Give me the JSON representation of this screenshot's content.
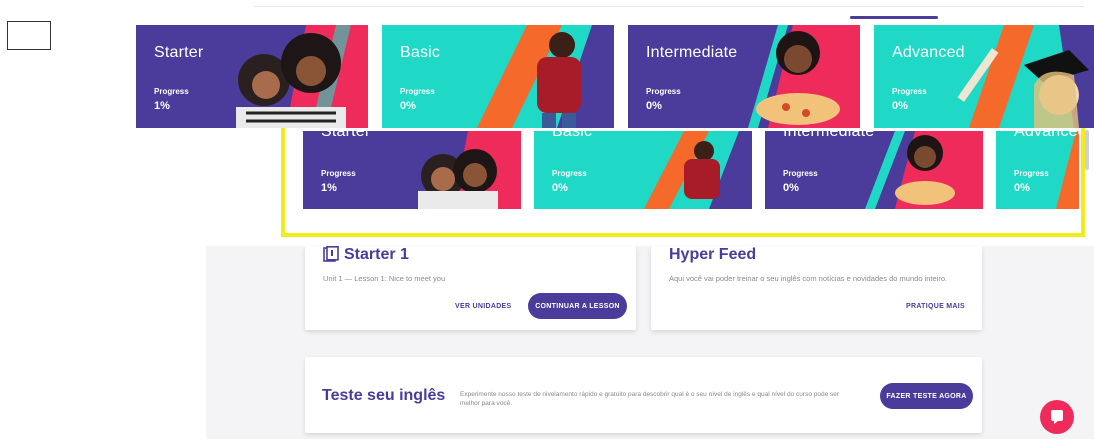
{
  "colors": {
    "purple": "#4b3c9c",
    "teal": "#1fd8c6",
    "pink": "#ef2b5b",
    "orange": "#f56a2a",
    "highlight": "#f2ec1d"
  },
  "courses": [
    {
      "title": "Starter",
      "progress_label": "Progress",
      "progress_value": "1%"
    },
    {
      "title": "Basic",
      "progress_label": "Progress",
      "progress_value": "0%"
    },
    {
      "title": "Intermediate",
      "progress_label": "Progress",
      "progress_value": "0%"
    },
    {
      "title": "Advanced",
      "progress_label": "Progress",
      "progress_value": "0%"
    }
  ],
  "lesson_card": {
    "title": "Starter 1",
    "subtitle": "Unit 1 — Lesson 1: Nice to meet you",
    "see_units": "VER UNIDADES",
    "continue": "CONTINUAR A LESSON"
  },
  "feed_card": {
    "title": "Hyper Feed",
    "subtitle": "Aqui você vai poder treinar o seu inglês com notícias e novidades do mundo inteiro.",
    "practice": "PRATIQUE MAIS"
  },
  "test_card": {
    "title": "Teste seu inglês",
    "description": "Experimente nosso teste de nivelamento rápido e gratuito para descobrir qual é o seu nível de inglês e qual nível do curso pode ser melhor para você.",
    "button": "FAZER TESTE AGORA"
  },
  "icons": {
    "lesson": "book-icon",
    "chat": "chat-icon"
  }
}
